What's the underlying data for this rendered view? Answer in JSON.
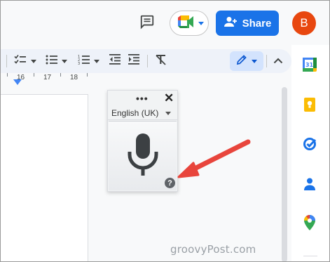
{
  "header": {
    "share_label": "Share",
    "avatar_initial": "B"
  },
  "ruler": {
    "labels": [
      "16",
      "17",
      "18"
    ]
  },
  "voice_typing": {
    "more_label": "•••",
    "close_label": "✕",
    "language": "English (UK)",
    "help_label": "?"
  },
  "watermark": "groovyPost.com",
  "colors": {
    "share_blue": "#1a73e8",
    "avatar_orange": "#e8470f",
    "arrow_red": "#e8453c",
    "edit_mode_bg": "#d3e3fd"
  },
  "icons": {
    "header": [
      "comment-icon",
      "meet-icon",
      "person-add-icon"
    ],
    "toolbar": [
      "checklist-icon",
      "bullet-list-icon",
      "numbered-list-icon",
      "decrease-indent-icon",
      "increase-indent-icon",
      "clear-formatting-icon",
      "pencil-icon",
      "chevron-up-icon"
    ],
    "side_panel": [
      "calendar-icon",
      "keep-icon",
      "tasks-icon",
      "contacts-icon",
      "maps-icon"
    ],
    "voice": [
      "microphone-icon"
    ]
  }
}
